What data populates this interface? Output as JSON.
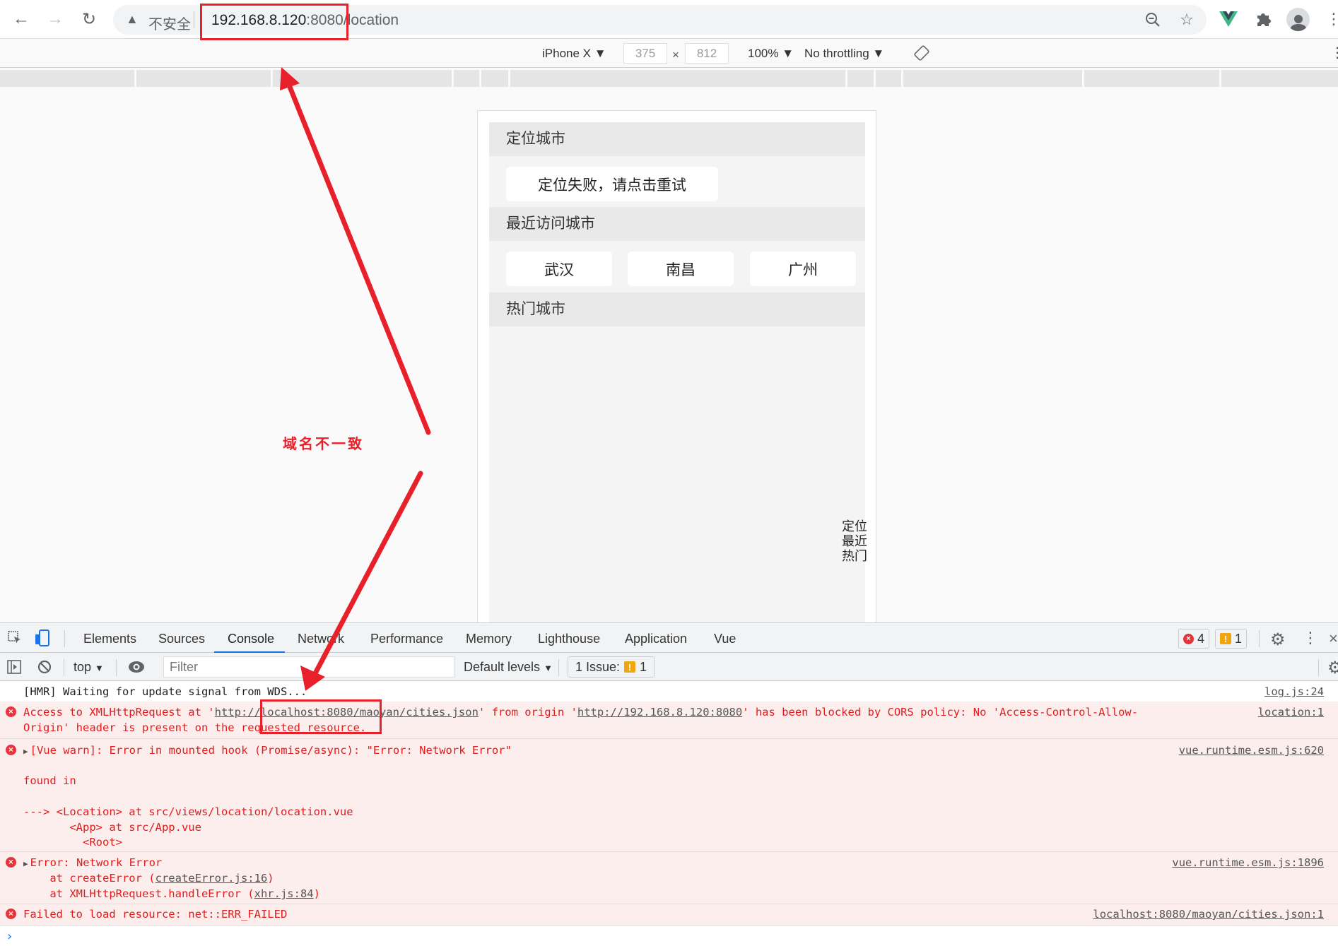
{
  "browser": {
    "security_label": "不安全",
    "url_host": "192.168.8.120",
    "url_port": ":8080",
    "url_path": "/location",
    "icons": [
      "back-icon",
      "forward-icon",
      "reload-icon",
      "warning-icon",
      "zoom-out-icon",
      "bookmark-star-icon",
      "vue-devtools-icon",
      "extensions-puzzle-icon",
      "profile-avatar-icon",
      "kebab-menu-icon"
    ]
  },
  "device_toolbar": {
    "device": "iPhone X",
    "width": "375",
    "height": "812",
    "times": "×",
    "zoom": "100%",
    "throttling": "No throttling"
  },
  "page": {
    "sections": [
      {
        "title": "定位城市"
      },
      {
        "title": "最近访问城市"
      },
      {
        "title": "热门城市"
      }
    ],
    "locate_retry_button": "定位失败，请点击重试",
    "recent_cities": [
      "武汉",
      "南昌",
      "广州"
    ],
    "index_nav": [
      "定位",
      "最近",
      "热门"
    ]
  },
  "devtools": {
    "tabs": [
      "Elements",
      "Sources",
      "Console",
      "Network",
      "Performance",
      "Memory",
      "Lighthouse",
      "Application",
      "Vue"
    ],
    "active_tab": "Console",
    "error_count": "4",
    "warning_count": "1",
    "context": "top",
    "filter_placeholder": "Filter",
    "levels": "Default levels",
    "issues_label": "1 Issue:",
    "issues_count": "1"
  },
  "console": {
    "messages": [
      {
        "type": "log",
        "text": "[HMR] Waiting for update signal from WDS...",
        "source": "log.js:24"
      },
      {
        "type": "error",
        "text_1a": "Access to XMLHttpRequest at '",
        "link_1": "http://localhost:8080/maoyan/cities.json",
        "text_1b": "' from origin '",
        "link_2": "http://192.168.8.120:8080",
        "text_1c": "' has been blocked by CORS policy: No 'Access-Control-Allow-",
        "text_2": "Origin' header is present on the requested resource.",
        "source": "location:1"
      },
      {
        "type": "error",
        "text": "[Vue warn]: Error in mounted hook (Promise/async): \"Error: Network Error\"",
        "found_in": "found in",
        "trace_1": "---> <Location> at src/views/location/location.vue",
        "trace_2": "       <App> at src/App.vue",
        "trace_3": "         <Root>",
        "source": "vue.runtime.esm.js:620"
      },
      {
        "type": "error",
        "text": "Error: Network Error",
        "stack_1_prefix": "    at createError (",
        "stack_1_link": "createError.js:16",
        "stack_2_prefix": "    at XMLHttpRequest.handleError (",
        "stack_2_link": "xhr.js:84",
        "close_paren": ")",
        "source": "vue.runtime.esm.js:1896"
      },
      {
        "type": "error",
        "text": "Failed to load resource: net::ERR_FAILED",
        "source": "localhost:8080/maoyan/cities.json:1"
      }
    ],
    "prompt": "›"
  },
  "annotation": {
    "text": "域名不一致",
    "color": "#e8202a"
  }
}
